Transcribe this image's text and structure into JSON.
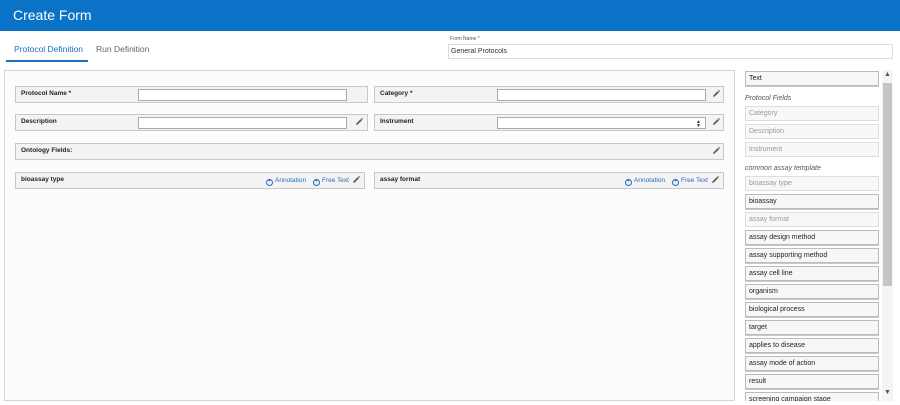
{
  "app": {
    "title": "Create Form"
  },
  "tabs": [
    {
      "label": "Protocol Definition",
      "active": true
    },
    {
      "label": "Run Definition",
      "active": false
    }
  ],
  "form_name": {
    "label": "Form Name *",
    "value": "General Protocols"
  },
  "fields": {
    "protocol_name": {
      "label": "Protocol Name *",
      "value": ""
    },
    "category": {
      "label": "Category *",
      "value": ""
    },
    "description": {
      "label": "Description",
      "value": ""
    },
    "instrument": {
      "label": "Instrument",
      "value": ""
    },
    "ontology": {
      "label": "Ontology Fields:"
    },
    "bioassay_type": {
      "label": "bioassay type",
      "annotation": "Annotation",
      "free_text": "Free Text"
    },
    "assay_format": {
      "label": "assay format",
      "annotation": "Annotation",
      "free_text": "Free Text"
    }
  },
  "sidebar": {
    "text_item": "Text",
    "protocol_fields_header": "Protocol Fields",
    "protocol_fields": [
      "Category",
      "Description",
      "Instrument"
    ],
    "template_header": "common assay template",
    "template_items": [
      {
        "label": "bioassay type",
        "disabled": true
      },
      {
        "label": "bioassay",
        "disabled": false
      },
      {
        "label": "assay format",
        "disabled": true
      },
      {
        "label": "assay design method",
        "disabled": false
      },
      {
        "label": "assay supporting method",
        "disabled": false
      },
      {
        "label": "assay cell line",
        "disabled": false
      },
      {
        "label": "organism",
        "disabled": false
      },
      {
        "label": "biological process",
        "disabled": false
      },
      {
        "label": "target",
        "disabled": false
      },
      {
        "label": "applies to disease",
        "disabled": false
      },
      {
        "label": "assay mode of action",
        "disabled": false
      },
      {
        "label": "result",
        "disabled": false
      },
      {
        "label": "screening campaign stage",
        "disabled": false
      }
    ]
  },
  "colors": {
    "accent": "#0a73c7",
    "link": "#2a6dbb"
  }
}
